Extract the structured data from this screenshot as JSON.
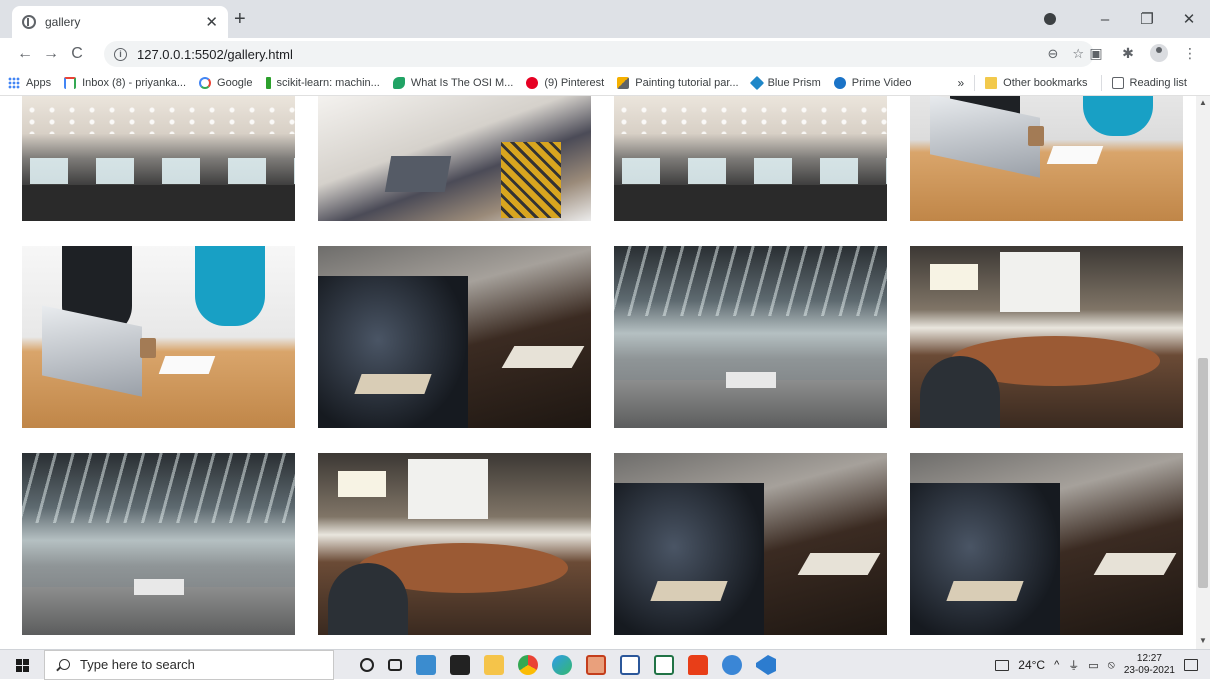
{
  "browser": {
    "tab": {
      "title": "gallery",
      "close_glyph": "✕"
    },
    "new_tab_glyph": "+",
    "window_controls": {
      "minimize": "–",
      "maximize": "❐",
      "close": "✕"
    },
    "nav": {
      "back": "←",
      "forward": "→",
      "reload": "C"
    },
    "address": {
      "url": "127.0.0.1:5502/gallery.html",
      "info_glyph": "i",
      "zoom_glyph": "⊖",
      "star_glyph": "☆"
    },
    "toolbar_icons": {
      "ext_glyph": "▣",
      "puzzle_glyph": "✱",
      "menu_glyph": "⋮"
    },
    "bookmarks": [
      {
        "label": "Apps",
        "icon": "apps-grid-icon"
      },
      {
        "label": "Inbox (8) - priyanka...",
        "icon": "gmail-icon"
      },
      {
        "label": "Google",
        "icon": "google-icon"
      },
      {
        "label": "scikit-learn: machin...",
        "icon": "scikit-learn-icon"
      },
      {
        "label": "What Is The OSI M...",
        "icon": "osi-icon"
      },
      {
        "label": "(9) Pinterest",
        "icon": "pinterest-icon"
      },
      {
        "label": "Painting tutorial par...",
        "icon": "painting-icon"
      },
      {
        "label": "Blue Prism",
        "icon": "blue-prism-icon"
      },
      {
        "label": "Prime Video",
        "icon": "prime-video-icon"
      }
    ],
    "bookmarks_more": "»",
    "other_bookmarks": "Other bookmarks",
    "reading_list": "Reading list"
  },
  "gallery": {
    "rows": [
      [
        "open-office",
        "team-meeting",
        "open-office",
        "desk-collaboration"
      ],
      [
        "desk-collaboration",
        "dark-meeting-table",
        "office-corridor",
        "conference-room"
      ],
      [
        "office-corridor",
        "conference-room",
        "dark-meeting-table",
        "dark-meeting-table"
      ]
    ]
  },
  "taskbar": {
    "search_placeholder": "Type here to search",
    "apps": [
      "cortana",
      "task-view",
      "photos",
      "store",
      "file-explorer",
      "chrome",
      "edge",
      "powerpoint",
      "word",
      "excel",
      "office",
      "blue-app",
      "vscode"
    ],
    "weather": "24°C",
    "tray_caret": "^",
    "time": "12:27",
    "date": "23-09-2021"
  }
}
